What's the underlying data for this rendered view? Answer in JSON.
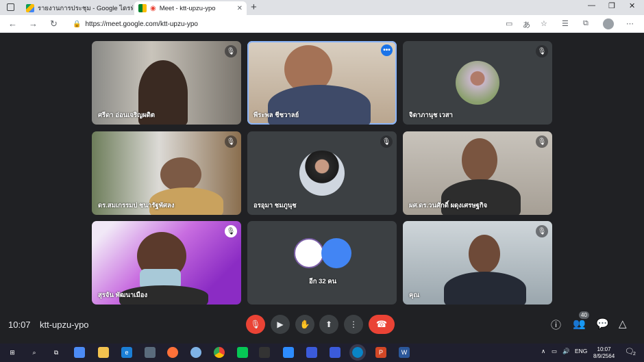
{
  "browser": {
    "tabs": [
      {
        "title": "รายงานการประชุม - Google ไดรฟ์",
        "favicon": "drive-icon"
      },
      {
        "title": "Meet - ktt-upzu-ypo",
        "favicon": "meet-icon"
      }
    ],
    "url": "https://meet.google.com/ktt-upzu-ypo"
  },
  "participants": [
    {
      "name": "ศรีดา อ่อนเจริญผดิต"
    },
    {
      "name": "พีระพล ชีชวาลย์"
    },
    {
      "name": "จิดาภานุช เวสา"
    },
    {
      "name": "ดร.สมเกรรมบ่ ชนารัฐพัศลง"
    },
    {
      "name": "อรอุมา ชมภูนุช"
    },
    {
      "name": "ผศ.ดร.วนศักดิ์ ผดุงเศรษฐกิจ"
    },
    {
      "name": "สุรจัน พัฒนาเมือง"
    },
    {
      "name": "อีก 32 คน"
    },
    {
      "name": "คุณ"
    }
  ],
  "bottom_bar": {
    "time": "10:07",
    "meeting_code": "ktt-upzu-ypo",
    "participant_count": "40"
  },
  "taskbar": {
    "lang": "ENG",
    "clock_time": "10:07",
    "clock_date": "8/9/2564",
    "notifications": "2"
  },
  "colors": {
    "accent": "#1a73e8",
    "danger": "#ea4335",
    "background": "#202124"
  }
}
